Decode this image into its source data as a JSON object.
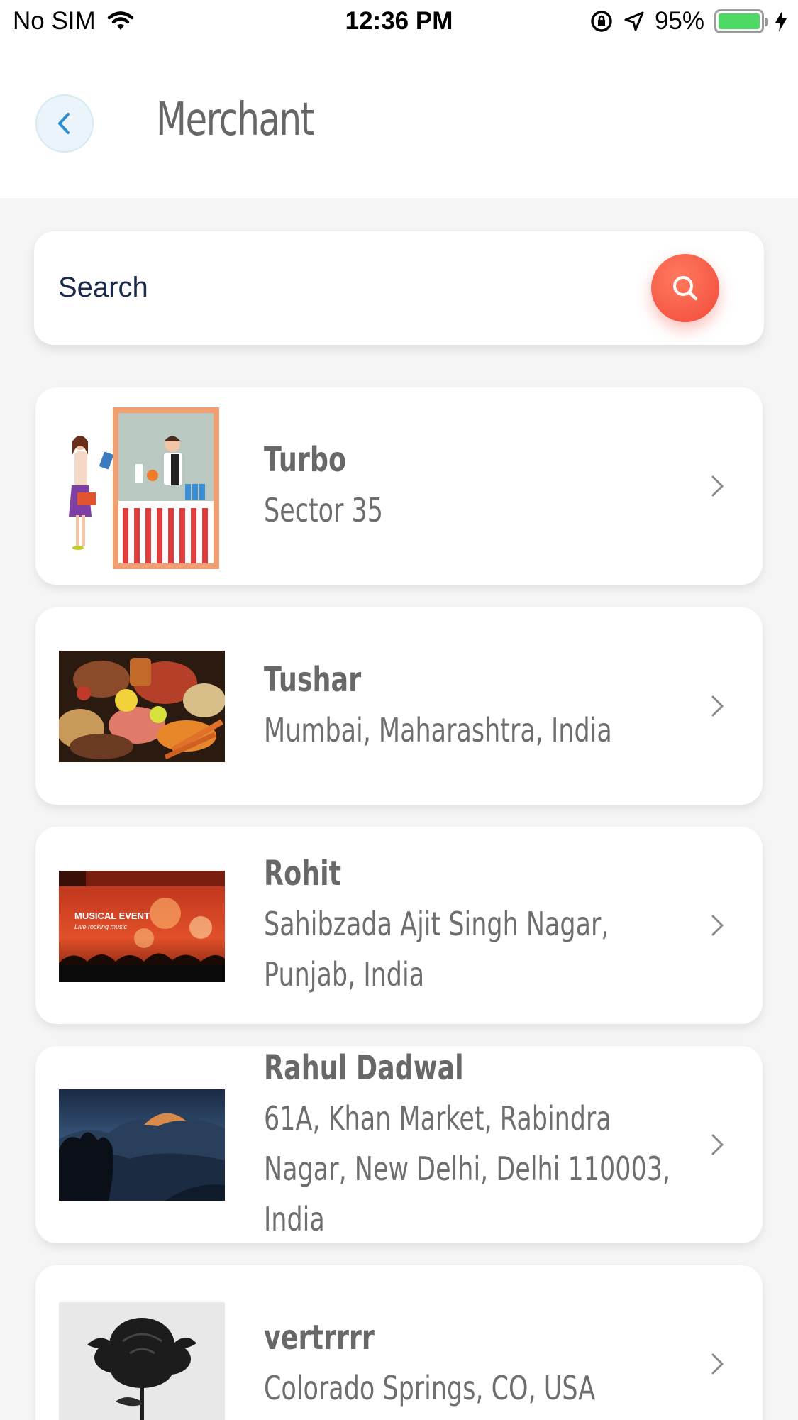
{
  "status_bar": {
    "carrier": "No SIM",
    "time": "12:36 PM",
    "battery": "95%"
  },
  "header": {
    "title": "Merchant"
  },
  "search": {
    "placeholder": "Search"
  },
  "merchants": [
    {
      "name": "Turbo",
      "address": "Sector 35",
      "thumb": "shop-illustration"
    },
    {
      "name": "Tushar",
      "address": "Mumbai, Maharashtra, India",
      "thumb": "groceries-photo"
    },
    {
      "name": "Rohit",
      "address": "Sahibzada Ajit Singh Nagar, Punjab, India",
      "thumb": "musical-event-photo"
    },
    {
      "name": "Rahul Dadwal",
      "address": "61A, Khan Market, Rabindra Nagar, New Delhi, Delhi 110003, India",
      "thumb": "mountain-landscape-photo"
    },
    {
      "name": "vertrrrr",
      "address": "Colorado Springs, CO, USA",
      "thumb": "black-rose-photo"
    }
  ],
  "thumb_texts": {
    "event_title": "MUSICAL EVENT",
    "event_subtitle": "Live rocking music"
  },
  "colors": {
    "accent": "#f24a3b",
    "back_button_bg": "#eaf4fa",
    "back_arrow": "#2b8fd6",
    "battery": "#4cd964"
  }
}
